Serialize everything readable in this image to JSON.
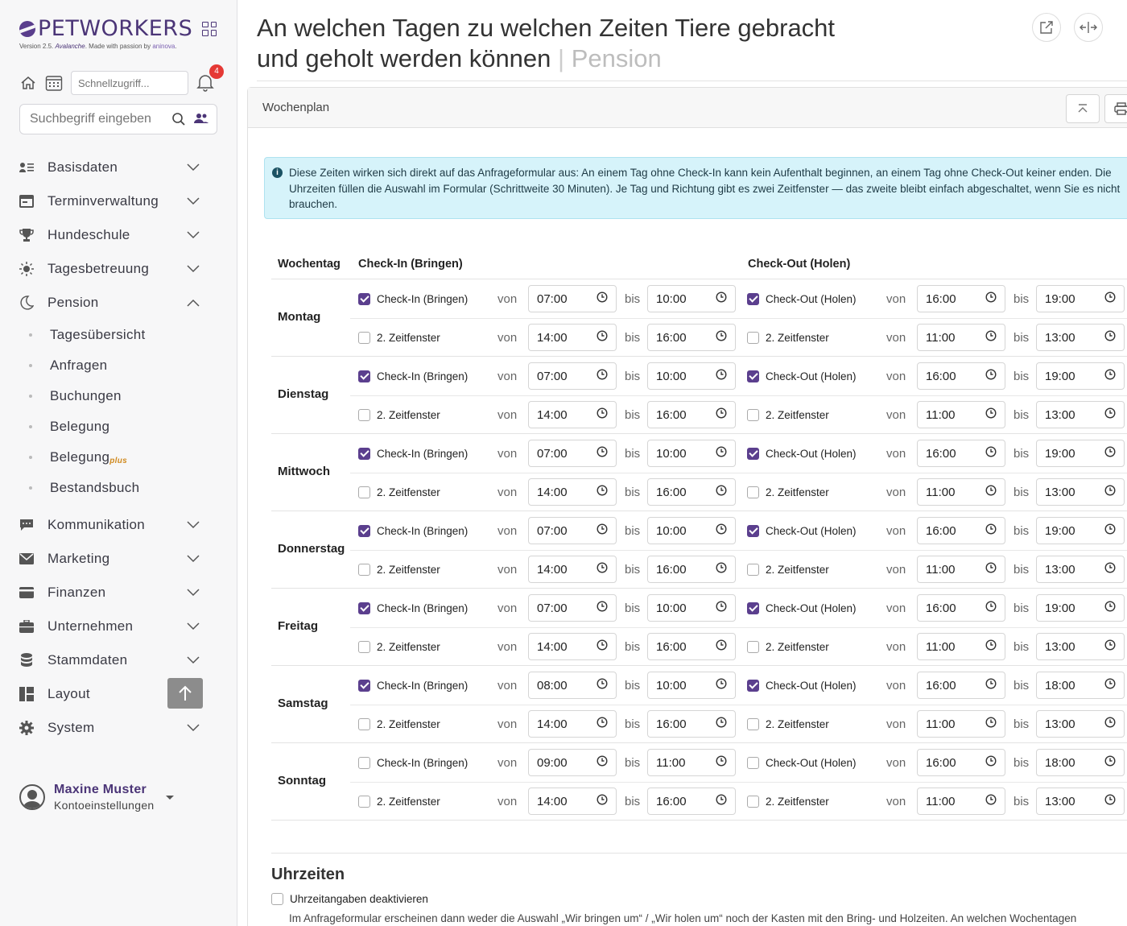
{
  "brand": {
    "name": "PETWORKERS",
    "version_prefix": "Version 2.5. ",
    "version_name": "Avalanche",
    "version_middle": ". Made with passion by ",
    "version_by": "aninova",
    "version_suffix": "."
  },
  "quick": {
    "placeholder": "Schnellzugriff...",
    "badge": "4"
  },
  "search": {
    "placeholder": "Suchbegriff eingeben"
  },
  "nav": {
    "items": [
      {
        "label": "Basisdaten",
        "icon": "user-list-icon"
      },
      {
        "label": "Terminverwaltung",
        "icon": "calendar-icon"
      },
      {
        "label": "Hundeschule",
        "icon": "trophy-icon"
      },
      {
        "label": "Tagesbetreuung",
        "icon": "sun-icon"
      },
      {
        "label": "Pension",
        "icon": "moon-icon"
      },
      {
        "label": "Kommunikation",
        "icon": "chat-icon"
      },
      {
        "label": "Marketing",
        "icon": "mail-icon"
      },
      {
        "label": "Finanzen",
        "icon": "card-icon"
      },
      {
        "label": "Unternehmen",
        "icon": "briefcase-icon"
      },
      {
        "label": "Stammdaten",
        "icon": "database-icon"
      },
      {
        "label": "Layout",
        "icon": "layout-icon"
      },
      {
        "label": "System",
        "icon": "gear-icon"
      }
    ],
    "pension_sub": [
      "Tagesübersicht",
      "Anfragen",
      "Buchungen",
      "Belegung",
      "Belegung",
      "Bestandsbuch"
    ],
    "plus": "plus"
  },
  "user": {
    "name": "Maxine Muster",
    "sub": "Kontoeinstellungen"
  },
  "page": {
    "title_line1": "An welchen Tagen zu welchen Zeiten Tiere gebracht",
    "title_line2": "und geholt werden können",
    "separator": "|",
    "subtitle": "Pension"
  },
  "card": {
    "title": "Wochenplan",
    "info": "Diese Zeiten wirken sich direkt auf das Anfrageformular aus: An einem Tag ohne Check-In kann kein Aufenthalt beginnen, an einem Tag ohne Check-Out keiner enden. Die Uhrzeiten füllen die Auswahl im Formular (Schrittweite 30 Minuten). Je Tag und Richtung gibt es zwei Zeitfenster — das zweite bleibt einfach abgeschaltet, wenn Sie es nicht brauchen."
  },
  "table": {
    "headers": {
      "day": "Wochentag",
      "checkin": "Check-In (Bringen)",
      "checkout": "Check-Out (Holen)"
    },
    "words": {
      "from": "von",
      "to": "bis",
      "second": "2. Zeitfenster",
      "in": "Check-In (Bringen)",
      "out": "Check-Out (Holen)"
    },
    "days": [
      {
        "name": "Montag",
        "in1": {
          "on": true,
          "from": "07:00",
          "to": "10:00"
        },
        "in2": {
          "on": false,
          "from": "14:00",
          "to": "16:00"
        },
        "out1": {
          "on": true,
          "from": "16:00",
          "to": "19:00"
        },
        "out2": {
          "on": false,
          "from": "11:00",
          "to": "13:00"
        }
      },
      {
        "name": "Dienstag",
        "in1": {
          "on": true,
          "from": "07:00",
          "to": "10:00"
        },
        "in2": {
          "on": false,
          "from": "14:00",
          "to": "16:00"
        },
        "out1": {
          "on": true,
          "from": "16:00",
          "to": "19:00"
        },
        "out2": {
          "on": false,
          "from": "11:00",
          "to": "13:00"
        }
      },
      {
        "name": "Mittwoch",
        "in1": {
          "on": true,
          "from": "07:00",
          "to": "10:00"
        },
        "in2": {
          "on": false,
          "from": "14:00",
          "to": "16:00"
        },
        "out1": {
          "on": true,
          "from": "16:00",
          "to": "19:00"
        },
        "out2": {
          "on": false,
          "from": "11:00",
          "to": "13:00"
        }
      },
      {
        "name": "Donnerstag",
        "in1": {
          "on": true,
          "from": "07:00",
          "to": "10:00"
        },
        "in2": {
          "on": false,
          "from": "14:00",
          "to": "16:00"
        },
        "out1": {
          "on": true,
          "from": "16:00",
          "to": "19:00"
        },
        "out2": {
          "on": false,
          "from": "11:00",
          "to": "13:00"
        }
      },
      {
        "name": "Freitag",
        "in1": {
          "on": true,
          "from": "07:00",
          "to": "10:00"
        },
        "in2": {
          "on": false,
          "from": "14:00",
          "to": "16:00"
        },
        "out1": {
          "on": true,
          "from": "16:00",
          "to": "19:00"
        },
        "out2": {
          "on": false,
          "from": "11:00",
          "to": "13:00"
        }
      },
      {
        "name": "Samstag",
        "in1": {
          "on": true,
          "from": "08:00",
          "to": "10:00"
        },
        "in2": {
          "on": false,
          "from": "14:00",
          "to": "16:00"
        },
        "out1": {
          "on": true,
          "from": "16:00",
          "to": "18:00"
        },
        "out2": {
          "on": false,
          "from": "11:00",
          "to": "13:00"
        }
      },
      {
        "name": "Sonntag",
        "in1": {
          "on": false,
          "from": "09:00",
          "to": "11:00"
        },
        "in2": {
          "on": false,
          "from": "14:00",
          "to": "16:00"
        },
        "out1": {
          "on": false,
          "from": "16:00",
          "to": "18:00"
        },
        "out2": {
          "on": false,
          "from": "11:00",
          "to": "13:00"
        }
      }
    ]
  },
  "uhrzeiten": {
    "title": "Uhrzeiten",
    "checkbox": "Uhrzeitangaben deaktivieren",
    "desc": "Im Anfrageformular erscheinen dann weder die Auswahl „Wir bringen um“ / „Wir holen um“ noch der Kasten mit den Bring- und Holzeiten. An welchen Wochentagen"
  },
  "colors": {
    "accent": "#5b3f8e",
    "info_bg": "#d6f3fa",
    "badge": "#e53935"
  }
}
